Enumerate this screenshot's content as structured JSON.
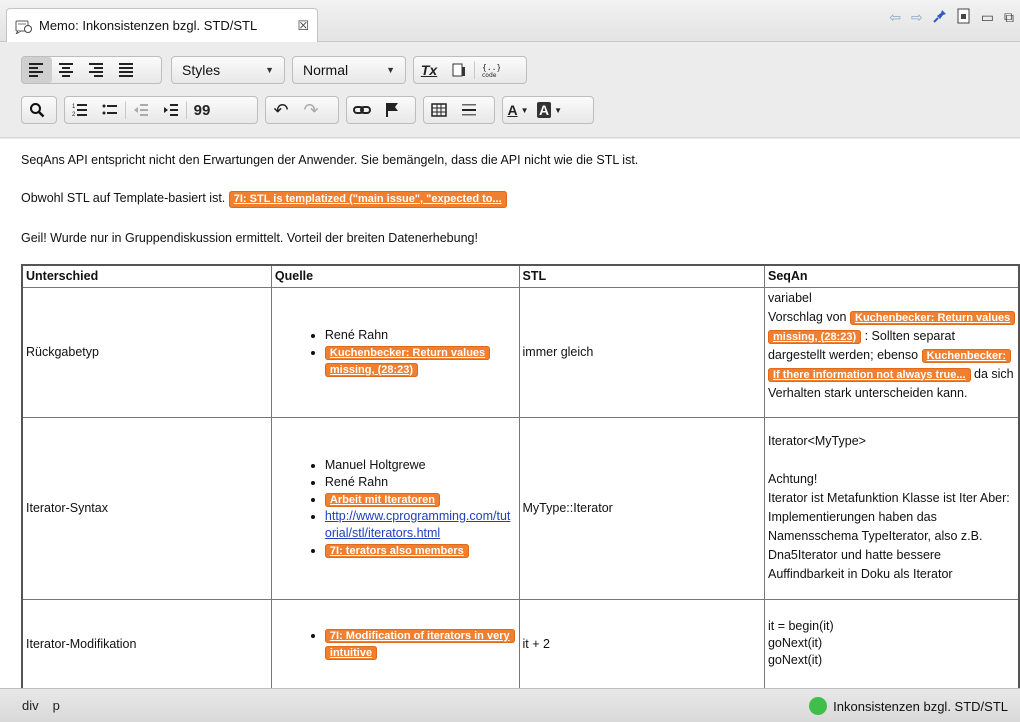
{
  "tab": {
    "title": "Memo: Inkonsistenzen bzgl. STD/STL",
    "close": "☒"
  },
  "view_actions": {
    "back": "⇦",
    "forward": "⇨",
    "pin": "📌",
    "minimize": "▭",
    "restore": "⧉"
  },
  "toolbar": {
    "style_combo": "Styles",
    "format_combo": "Normal",
    "clear_format": "Tx",
    "quote": "99",
    "undo": "↶",
    "redo": "↷",
    "font_color": "A",
    "bg_color": "A"
  },
  "doc": {
    "p1": "SeqAns API entspricht nicht den Erwartungen der Anwender. Sie bemängeln, dass die API nicht wie die STL ist.",
    "p2_text": "Obwohl STL auf Template-basiert ist.",
    "p2_code": "7I: STL is templatized (\"main issue\", \"expected to...",
    "p3": "Geil! Wurde nur in Gruppendiskussion ermittelt. Vorteil der breiten Datenerhebung!"
  },
  "table": {
    "headers": [
      "Unterschied",
      "Quelle",
      "STL",
      "SeqAn"
    ],
    "rows": [
      {
        "unterschied": "Rückgabetyp",
        "quelle": [
          "René Rahn",
          "Kuchenbecker: Return values missing, (28:23)"
        ],
        "stl": "immer gleich",
        "seqan": {
          "line1": "variabel",
          "pre": "Vorschlag von",
          "code1": "Kuchenbecker: Return values missing, (28:23)",
          "mid": ": Sollten separat dargestellt werden; ebenso",
          "code2": "Kuchenbecker: If there information not always true...",
          "post": "da sich Verhalten stark unterscheiden kann."
        }
      },
      {
        "unterschied": "Iterator-Syntax",
        "quelle": [
          "Manuel Holtgrewe",
          "René Rahn",
          "Arbeit mit Iteratoren",
          "http://www.cprogramming.com/tutorial/stl/iterators.html",
          "7I: terators also members"
        ],
        "stl": "MyType::Iterator",
        "seqan": {
          "line1": "Iterator<MyType>",
          "line2": "Achtung!",
          "line3": "Iterator ist Metafunktion Klasse ist Iter Aber: Implementierungen haben das Namensschema TypeIterator, also z.B. Dna5Iterator und hatte bessere Auffindbarkeit in Doku als Iterator"
        }
      },
      {
        "unterschied": "Iterator-Modifikation",
        "quelle": [
          "7I: Modification of iterators in very intuitive"
        ],
        "stl": "it + 2",
        "seqan": {
          "line1": "it = begin(it)",
          "line2": "goNext(it)",
          "line3": "goNext(it)"
        }
      }
    ]
  },
  "status": {
    "path": [
      "div",
      "p"
    ],
    "label": "Inkonsistenzen bzgl. STD/STL"
  },
  "colors": {
    "code_tag": "#f07f2f",
    "status_ok": "#3fbf4a",
    "link": "#1f3fbf"
  }
}
